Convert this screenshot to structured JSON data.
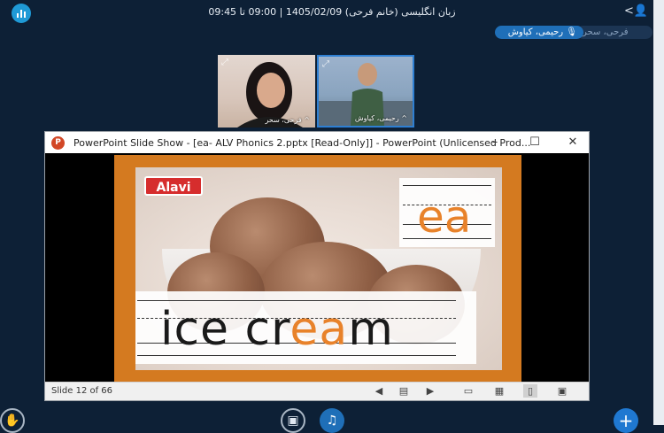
{
  "top_bar": {
    "meeting_title": "زبان انگلیسی (خانم فرحی) 1405/02/09 | 09:00 تا 09:45",
    "user_menu_icon": "<👤"
  },
  "participant_pills": [
    {
      "label": "فرحی، سحر"
    },
    {
      "label": "🎙 رحیمی، کیاوش"
    }
  ],
  "webcams": [
    {
      "label": "^ فرحی، سحر"
    },
    {
      "label": "^ رحیمی، کیاوش"
    }
  ],
  "ppt": {
    "logo": "P",
    "window_title": "PowerPoint Slide Show - [ea- ALV Phonics 2.pptx [Read-Only]] - PowerPoint (Unlicensed Prod...",
    "minimize": "–",
    "maximize": "☐",
    "close": "✕",
    "slide": {
      "brand": "Alavi",
      "phonics_pattern": "ea",
      "word_start": "ice cr",
      "word_highlight": "ea",
      "word_end": "m"
    },
    "status": {
      "slide_counter": "Slide 12 of 66"
    }
  },
  "colors": {
    "background": "#0d2036",
    "accent_blue": "#1f6fb8",
    "slide_orange": "#d47a20",
    "highlight_orange": "#e8822a",
    "brand_red": "#d62d2d"
  }
}
